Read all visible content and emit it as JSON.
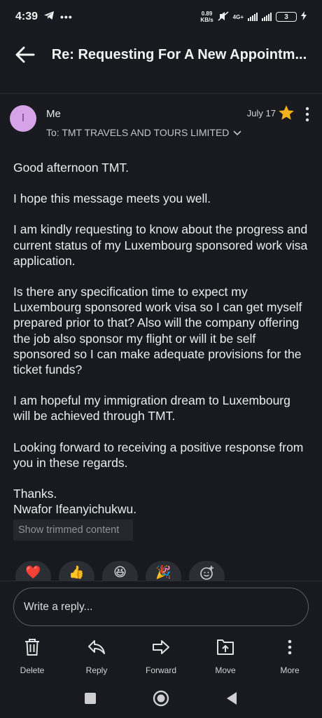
{
  "status_bar": {
    "time": "4:39",
    "net_speed_value": "0.89",
    "net_speed_unit": "KB/s",
    "network": "4G+",
    "battery": "3"
  },
  "appbar": {
    "title": "Re: Requesting For A New Appointm..."
  },
  "header": {
    "avatar_letter": "I",
    "avatar_color": "#d7a3e8",
    "sender": "Me",
    "to": "To:  TMT TRAVELS AND TOURS LIMITED",
    "date": "July 17",
    "star_color": "#f5b01d"
  },
  "message": {
    "p1": "Good afternoon TMT.",
    "p2": "I hope this message meets you well.",
    "p3": "I am kindly requesting to know about the progress and current status of my Luxembourg sponsored work visa application.",
    "p4": "Is there any specification time to expect my Luxembourg sponsored work visa so I can get myself prepared prior to that? Also will the company offering the job also sponsor my flight or will it be self sponsored so I can make adequate provisions for the ticket funds?",
    "p5": "I am hopeful my immigration dream to Luxembourg will be achieved through TMT.",
    "p6": "Looking forward to receiving a positive response from you in these regards.",
    "closing": "Thanks.",
    "signature": "Nwafor Ifeanyichukwu."
  },
  "trimmed_label": "Show trimmed content",
  "reactions": [
    "❤️",
    "👍",
    "😆",
    "🎉",
    "add-reaction-icon"
  ],
  "reply_placeholder": "Write a reply...",
  "actions": [
    {
      "label": "Delete",
      "icon": "trash-icon"
    },
    {
      "label": "Reply",
      "icon": "reply-icon"
    },
    {
      "label": "Forward",
      "icon": "forward-icon"
    },
    {
      "label": "Move",
      "icon": "move-icon"
    },
    {
      "label": "More",
      "icon": "more-icon"
    }
  ]
}
